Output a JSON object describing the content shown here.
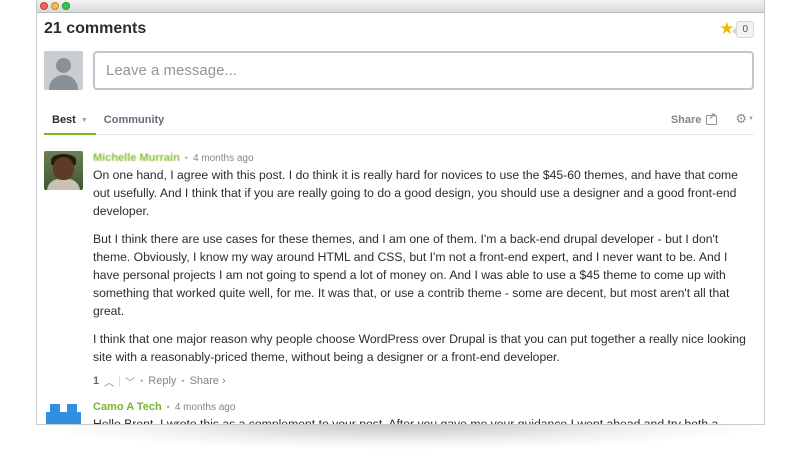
{
  "header": {
    "comment_count_title": "21 comments",
    "favorite_count": "0"
  },
  "composer": {
    "placeholder": "Leave a message..."
  },
  "tabs": [
    {
      "label": "Best",
      "active": true
    },
    {
      "label": "Community",
      "active": false
    }
  ],
  "toolbar": {
    "share_label": "Share"
  },
  "comments": [
    {
      "author": "Michelle Murrain",
      "time": "4 months ago",
      "paragraphs": [
        "On one hand, I agree with this post. I do think it is really hard for novices to use the $45-60 themes, and have that come out usefully. And I think that if you are really going to do a good design, you should use a designer and a good front-end developer.",
        "But I think there are use cases for these themes, and I am one of them. I'm a back-end drupal developer - but I don't theme. Obviously, I know my way around HTML and CSS, but I'm not a front-end expert, and I never want to be. And I have personal projects I am not going to spend a lot of money on. And I was able to use a $45 theme to come up with something that worked quite well, for me. It was that, or use a contrib theme - some are decent, but most aren't all that great.",
        "I think that one major reason why people choose WordPress over Drupal is that you can put together a really nice looking site with a reasonably-priced theme, without being a designer or a front-end developer."
      ],
      "votes": "1",
      "reply_label": "Reply",
      "share_label": "Share ›"
    },
    {
      "author": "Camo A Tech",
      "time": "4 months ago",
      "paragraphs": [
        "Hello Brent, I wrote this as a complement to your post. After you gave me your guidance I went ahead and try both a"
      ]
    }
  ],
  "colors": {
    "accent_green": "#7ab52e",
    "star": "#f5b800",
    "logo_blue": "#2f8fe0"
  }
}
